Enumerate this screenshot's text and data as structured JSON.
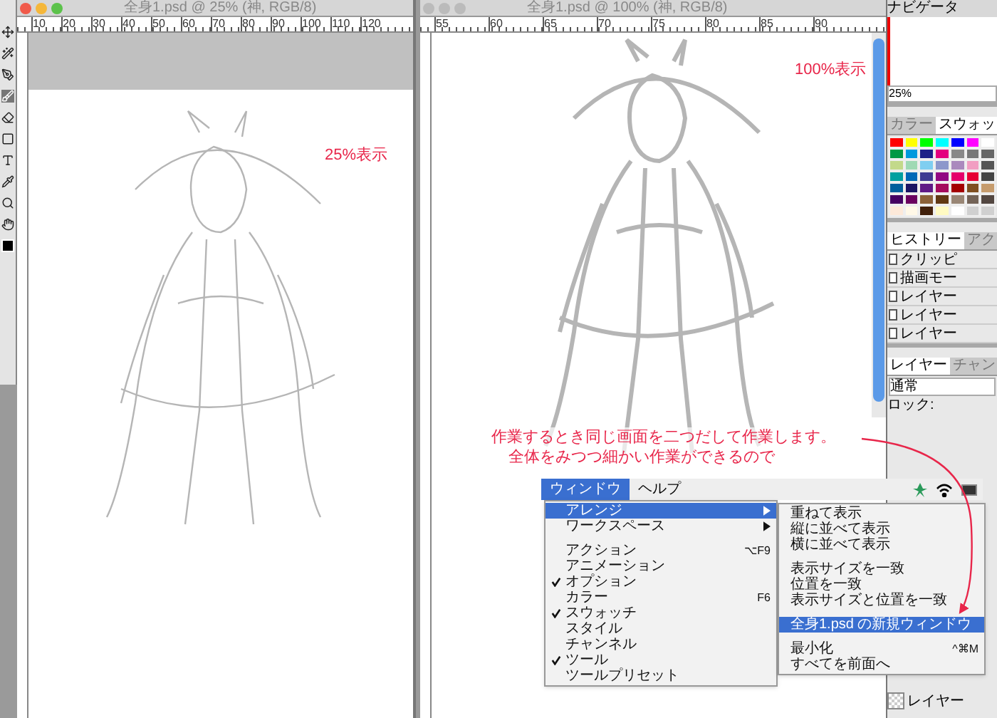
{
  "left_window": {
    "title": "全身1.psd @ 25% (神, RGB/8)",
    "ruler": [
      "10",
      "20",
      "30",
      "40",
      "50",
      "60",
      "70",
      "80",
      "90",
      "100",
      "110",
      "120"
    ],
    "annotation": "25%表示"
  },
  "right_window": {
    "title": "全身1.psd @ 100% (神, RGB/8)",
    "ruler": [
      "55",
      "60",
      "65",
      "70",
      "75",
      "80",
      "85",
      "90"
    ],
    "annotation": "100%表示"
  },
  "note": [
    "作業するとき同じ画面を二つだして作業します。",
    "全体をみつつ細かい作業ができるので"
  ],
  "menu_bar": [
    {
      "label": "ウィンドウ",
      "selected": true
    },
    {
      "label": "ヘルプ",
      "selected": false
    }
  ],
  "window_menu": [
    {
      "kind": "submenu",
      "label": "アレンジ",
      "selected": true,
      "checked": false
    },
    {
      "kind": "submenu",
      "label": "ワークスペース",
      "selected": false,
      "checked": false
    },
    {
      "kind": "separator"
    },
    {
      "kind": "item",
      "label": "アクション",
      "shortcut": "⌥F9",
      "selected": false,
      "checked": false
    },
    {
      "kind": "item",
      "label": "アニメーション",
      "selected": false,
      "checked": false
    },
    {
      "kind": "item",
      "label": "オプション",
      "selected": false,
      "checked": true
    },
    {
      "kind": "item",
      "label": "カラー",
      "shortcut": "F6",
      "selected": false,
      "checked": false
    },
    {
      "kind": "item",
      "label": "スウォッチ",
      "selected": false,
      "checked": true
    },
    {
      "kind": "item",
      "label": "スタイル",
      "selected": false,
      "checked": false
    },
    {
      "kind": "item",
      "label": "チャンネル",
      "selected": false,
      "checked": false
    },
    {
      "kind": "item",
      "label": "ツール",
      "selected": false,
      "checked": true
    },
    {
      "kind": "item",
      "label": "ツールプリセット",
      "selected": false,
      "checked": false
    }
  ],
  "arrange_submenu": [
    {
      "kind": "item",
      "label": "重ねて表示",
      "selected": false
    },
    {
      "kind": "item",
      "label": "縦に並べて表示",
      "selected": false
    },
    {
      "kind": "item",
      "label": "横に並べて表示",
      "selected": false
    },
    {
      "kind": "separator"
    },
    {
      "kind": "item",
      "label": "表示サイズを一致",
      "selected": false
    },
    {
      "kind": "item",
      "label": "位置を一致",
      "selected": false
    },
    {
      "kind": "item",
      "label": "表示サイズと位置を一致",
      "selected": false
    },
    {
      "kind": "separator"
    },
    {
      "kind": "item",
      "label": "全身1.psd の新規ウィンドウ",
      "selected": true
    },
    {
      "kind": "separator"
    },
    {
      "kind": "item",
      "label": "最小化",
      "shortcut": "^⌘M",
      "selected": false
    },
    {
      "kind": "item",
      "label": "すべてを前面へ",
      "selected": false
    }
  ],
  "navigator": {
    "tab": "ナビゲータ",
    "zoom": "25%"
  },
  "swatches": {
    "tabs": [
      {
        "label": "カラー",
        "selected": false
      },
      {
        "label": "スウォッ",
        "selected": true
      }
    ]
  },
  "history": {
    "tabs": [
      {
        "label": "ヒストリー",
        "selected": true
      },
      {
        "label": "アク",
        "selected": false
      }
    ],
    "items": [
      "クリッピ",
      "描画モー",
      "レイヤー",
      "レイヤー",
      "レイヤー"
    ]
  },
  "layers": {
    "tabs": [
      {
        "label": "レイヤー",
        "selected": true
      },
      {
        "label": "チャン",
        "selected": false
      }
    ],
    "blend": "通常",
    "lock": "ロック:",
    "items": [
      "レイヤー"
    ]
  }
}
